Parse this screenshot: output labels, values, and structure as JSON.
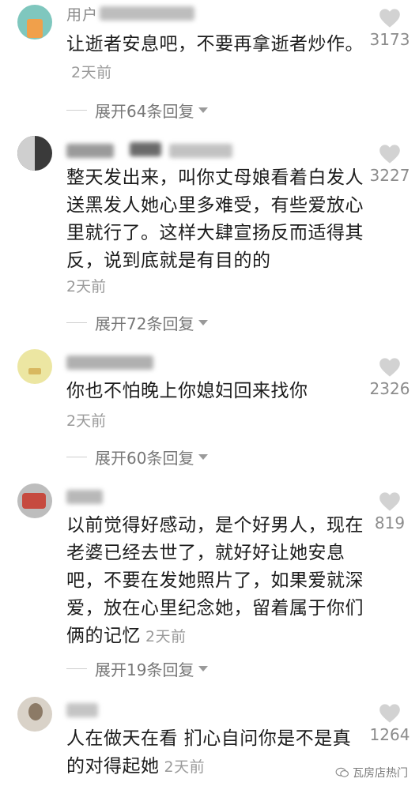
{
  "comments": [
    {
      "username": "用户",
      "text": "让逝者安息吧，不要再拿逝者炒作。",
      "time": "2天前",
      "likes": "3173",
      "expand": "展开64条回复"
    },
    {
      "username": "",
      "text": "整天发出来，叫你丈母娘看着白发人送黑发人她心里多难受，有些爱放心里就行了。这样大肆宣扬反而适得其反，说到底就是有目的的",
      "time": "2天前",
      "likes": "3227",
      "expand": "展开72条回复"
    },
    {
      "username": "",
      "text": "你也不怕晚上你媳妇回来找你",
      "time": "2天前",
      "likes": "2326",
      "expand": "展开60条回复"
    },
    {
      "username": "",
      "text": "以前觉得好感动，是个好男人，现在老婆已经去世了，就好好让她安息吧，不要在发她照片了，如果爱就深爱，放在心里纪念她，留着属于你们俩的记忆",
      "time": "2天前",
      "likes": "819",
      "expand": "展开19条回复"
    },
    {
      "username": "",
      "text": "人在做天在看 扪心自问你是不是真的对得起她",
      "time": "2天前",
      "likes": "1264",
      "expand": ""
    }
  ],
  "watermark": "瓦房店热门",
  "colors": {
    "text": "#1c1c1c",
    "muted": "#9a9a9a",
    "heart": "#d2d2d2"
  }
}
